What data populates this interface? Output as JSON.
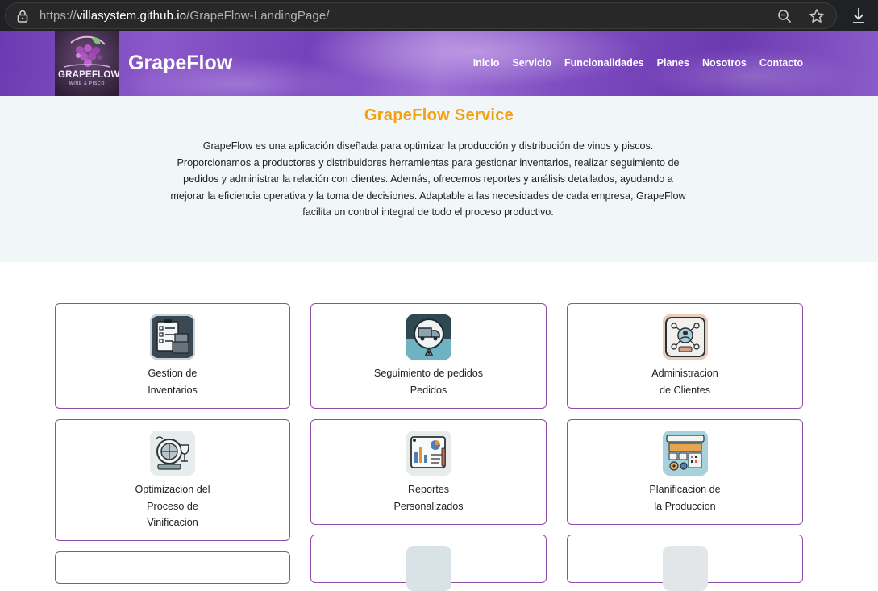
{
  "browser": {
    "url_scheme": "https://",
    "url_host": "villasystem.github.io",
    "url_path": "/GrapeFlow-LandingPage/"
  },
  "header": {
    "logo_word": "GRAPEFLOW",
    "logo_sub": "WINE & PISCO",
    "brand": "GrapeFlow",
    "nav": [
      "Inicio",
      "Servicio",
      "Funcionalidades",
      "Planes",
      "Nosotros",
      "Contacto"
    ]
  },
  "intro": {
    "title": "GrapeFlow Service",
    "text": "GrapeFlow es una aplicación diseñada para optimizar la producción y distribución de vinos y piscos. Proporcionamos a productores y distribuidores herramientas para gestionar inventarios, realizar seguimiento de pedidos y administrar la relación con clientes. Además, ofrecemos reportes y análisis detallados, ayudando a mejorar la eficiencia operativa y la toma de decisiones. Adaptable a las necesidades de cada empresa, GrapeFlow facilita un control integral de todo el proceso productivo."
  },
  "cards": [
    {
      "lines": [
        "Gestion de",
        "Inventarios"
      ],
      "icon": "inventory-clipboard-icon"
    },
    {
      "lines": [
        "Seguimiento de pedidos",
        "Pedidos"
      ],
      "icon": "delivery-truck-icon"
    },
    {
      "lines": [
        "Administracion",
        "de Clientes"
      ],
      "icon": "client-network-icon"
    },
    {
      "lines": [
        "Optimizacion del",
        "Proceso de",
        "Vinificacion"
      ],
      "icon": "wine-barrel-icon"
    },
    {
      "lines": [
        "Reportes",
        "Personalizados"
      ],
      "icon": "report-chart-icon"
    },
    {
      "lines": [
        "Planificacion de",
        "la Produccion"
      ],
      "icon": "production-calendar-icon"
    }
  ],
  "colors": {
    "accent_orange": "#f5a00f",
    "card_border": "#8f4fa6",
    "header_purple": "#7442bb",
    "intro_bg": "#f1f6f9"
  }
}
